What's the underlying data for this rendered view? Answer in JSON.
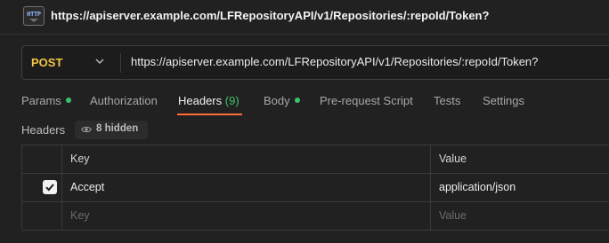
{
  "tab_bar": {
    "icon": "http-icon",
    "icon_text": "HTTP",
    "url": "https://apiserver.example.com/LFRepositoryAPI/v1/Repositories/:repoId/Token?"
  },
  "request": {
    "method": "POST",
    "method_color": "#f4c542",
    "url": "https://apiserver.example.com/LFRepositoryAPI/v1/Repositories/:repoId/Token?"
  },
  "tabs": [
    {
      "label": "Params",
      "dot": true
    },
    {
      "label": "Authorization"
    },
    {
      "label": "Headers",
      "count": "(9)",
      "active": true
    },
    {
      "label": "Body",
      "dot": true
    },
    {
      "label": "Pre-request Script"
    },
    {
      "label": "Tests"
    },
    {
      "label": "Settings"
    }
  ],
  "accent_color": "#ff6c37",
  "status_color": "#3cc26b",
  "headers_section": {
    "label": "Headers",
    "hidden_label": "8 hidden"
  },
  "table": {
    "columns": [
      "Key",
      "Value"
    ],
    "rows": [
      {
        "checked": true,
        "key": "Accept",
        "value": "application/json"
      }
    ],
    "placeholder": {
      "key": "Key",
      "value": "Value"
    }
  }
}
